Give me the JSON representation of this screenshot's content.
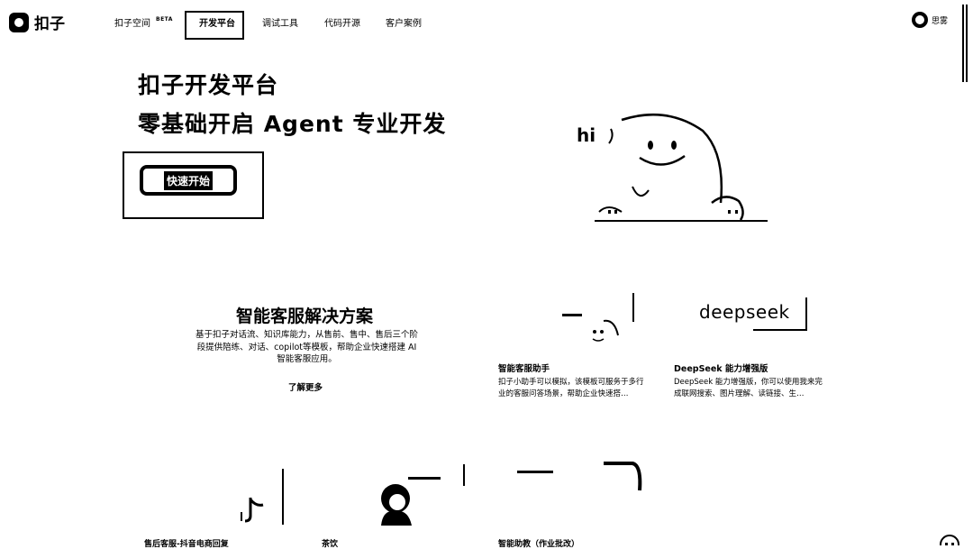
{
  "header": {
    "brand": "扣子",
    "nav": [
      {
        "label": "扣子空间",
        "badge": "BETA"
      },
      {
        "label": "开发平台",
        "active": true
      },
      {
        "label": "调试工具"
      },
      {
        "label": "代码开源"
      },
      {
        "label": "客户案例"
      }
    ],
    "user_name": "思雾"
  },
  "hero": {
    "title_line1": "扣子开发平台",
    "title_line2": "零基础开启 Agent 专业开发",
    "cta_label": "快速开始",
    "mascot_text": "hi"
  },
  "solutions": {
    "title": "智能客服解决方案",
    "description": "基于扣子对话流、知识库能力，从售前、售中、售后三个阶段提供陪练、对话、copilot等模板，帮助企业快速搭建 AI 智能客服应用。",
    "link_label": "了解更多",
    "cards": [
      {
        "title": "智能客服助手",
        "description": "扣子小助手可以模拟，该模板可服务于多行业的客服问答场景，帮助企业快速搭…"
      },
      {
        "title": "DeepSeek 能力增强版",
        "description": "DeepSeek 能力增强版，你可以使用我来完成联网搜索、图片理解、读链接、生…",
        "logo_text": "deepseek"
      }
    ]
  },
  "bottom_cards": [
    {
      "label": "售后客服-抖音电商回复"
    },
    {
      "label": "茶饮"
    },
    {
      "label": "智能助教（作业批改）"
    }
  ]
}
